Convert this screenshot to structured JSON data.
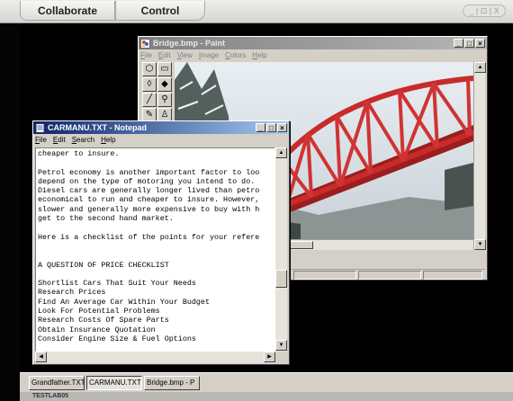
{
  "app_toolbar": {
    "tabs": [
      {
        "label": "Collaborate"
      },
      {
        "label": "Control"
      }
    ],
    "remote_controls_label": "_ | ⊡ | X"
  },
  "paint_window": {
    "title": "Bridge.bmp - Paint",
    "menu": [
      "File",
      "Edit",
      "View",
      "Image",
      "Colors",
      "Help"
    ],
    "palette_colors": [
      "#000000",
      "#808080",
      "#800000",
      "#808000",
      "#008000",
      "#008080",
      "#000080",
      "#800080",
      "#d86b1f",
      "#ffffff",
      "#c0c0c0",
      "#ff0000",
      "#ffff00",
      "#00ff00",
      "#00ffff",
      "#0000ff"
    ],
    "active_window": false
  },
  "notepad_window": {
    "title": "CARMANU.TXT - Notepad",
    "menu": [
      "File",
      "Edit",
      "Search",
      "Help"
    ],
    "text": "cheaper to insure.\n\nPetrol economy is another important factor to loo\ndepend on the type of motoring you intend to do.\nDiesel cars are generally longer lived than petro\neconomical to run and cheaper to insure. However,\nslower and generally more expensive to buy with h\nget to the second hand market.\n\nHere is a checklist of the points for your refere\n\n\nA QUESTION OF PRICE CHECKLIST\n\nShortlist Cars That Suit Your Needs\nResearch Prices\nFind An Average Car Within Your Budget\nLook For Potential Problems\nResearch Costs Of Spare Parts\nObtain Insurance Quotation\nConsider Engine Size & Fuel Options",
    "active_window": true
  },
  "taskbar": {
    "items": [
      {
        "label": "Grandfather.TXT"
      },
      {
        "label": "CARMANU.TXT"
      },
      {
        "label": "Bridge.bmp - P"
      }
    ]
  },
  "bottom_bar": {
    "label": "TESTLAB05"
  }
}
